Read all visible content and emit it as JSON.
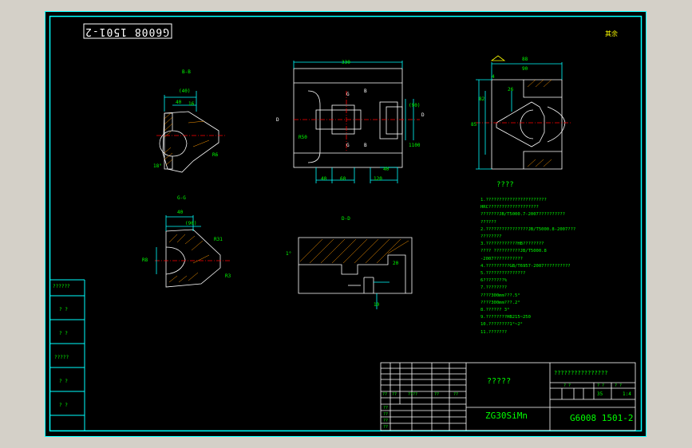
{
  "drawing_number_mirror": "G6008 1501-2",
  "roughness_mark": "其余",
  "section_labels": {
    "b_b": "B-B",
    "g_g": "G-G",
    "d_d": "D-D"
  },
  "dimensions": {
    "b_b": [
      "(40)",
      "40",
      "16",
      "R6",
      "18°"
    ],
    "front": [
      "330",
      "D",
      "D",
      "B",
      "B",
      "G",
      "G",
      "R50",
      "40",
      "60",
      "120",
      "40",
      "(90)",
      "1100"
    ],
    "side": [
      "88",
      "90",
      "85",
      "82",
      "26",
      "4"
    ],
    "g_g": [
      "40",
      "(90)",
      "R31",
      "R8",
      "R3"
    ],
    "d_d": [
      "1°",
      "20",
      "10"
    ]
  },
  "notes": {
    "title": "????",
    "items": [
      "1.???????????????????????",
      "HRC???????????????????",
      "???????JB/T5000.7-2007??????????",
      "??????",
      "2.????????????????JB/T5000.8-2007???",
      "????????",
      "3.????????????HB????????",
      "????  ??????????JB/T5000.8",
      "-2007???????????",
      "4.?????????GB/T6957-2007??????????",
      "5.???????????????",
      "6????????%",
      "7.????????",
      "????300mm???.5°",
      "????300mm???.2°",
      "8.?????? 3°",
      "9.????????HB215~250",
      "10.????????1°~2°",
      "11.???????"
    ]
  },
  "left_column": [
    "??????",
    "?  ?",
    "?  ?",
    "?????",
    "?  ?",
    "?  ?"
  ],
  "title_block": {
    "material": "ZG30SiMn",
    "part_name": "?????",
    "company": "????????????????",
    "drawing_number": "G6008 1501-2",
    "header_cells": [
      "?  ?",
      "?  ?",
      "?  ?"
    ],
    "scale_cells": [
      "35",
      "1:4"
    ],
    "left_cells": [
      "??",
      "??",
      "????",
      "??",
      "??"
    ],
    "left_rows": [
      "??",
      "??",
      "??",
      "??"
    ]
  }
}
